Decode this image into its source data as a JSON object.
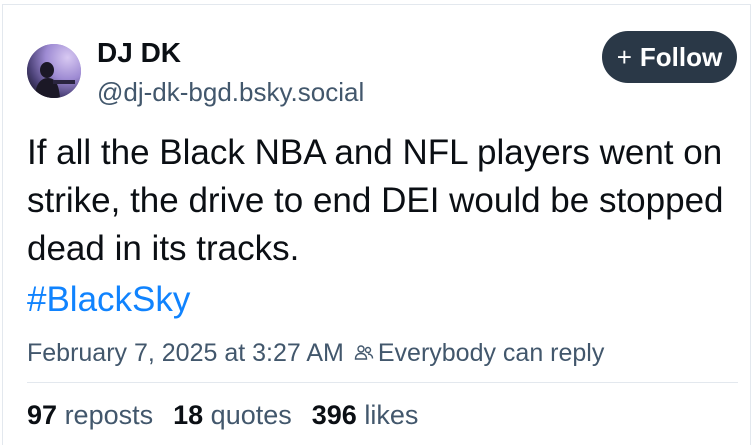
{
  "author": {
    "display_name": "DJ DK",
    "handle": "@dj-dk-bgd.bsky.social"
  },
  "follow_button": {
    "plus": "+",
    "label": "Follow"
  },
  "post": {
    "text": "If all the Black NBA and NFL players went on strike, the drive to end DEI would be stopped dead in its tracks.",
    "hashtag": "#BlackSky",
    "timestamp": "February 7, 2025 at 3:27 AM",
    "reply_setting": "Everybody can reply"
  },
  "stats": {
    "reposts_count": "97",
    "reposts_label": "reposts",
    "quotes_count": "18",
    "quotes_label": "quotes",
    "likes_count": "396",
    "likes_label": "likes"
  },
  "colors": {
    "text_primary": "#0b0f14",
    "text_secondary": "#42576c",
    "link": "#1083fe",
    "follow_bg": "#2a3847"
  },
  "icons": {
    "people": "people-icon"
  }
}
